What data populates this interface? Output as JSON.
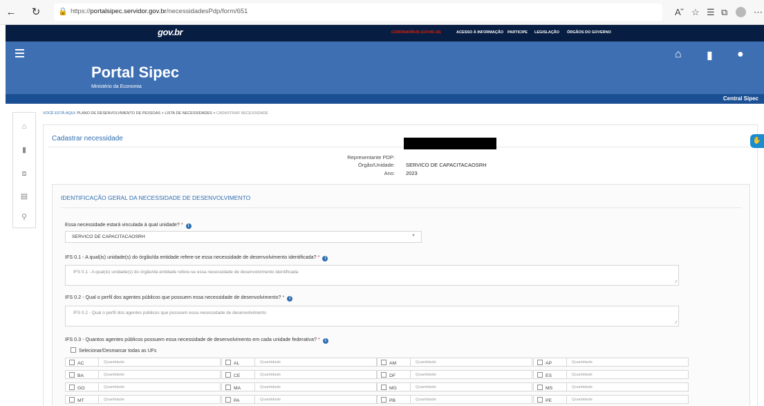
{
  "browser": {
    "back_icon": "arrow-left-icon",
    "reload_icon": "reload-icon",
    "url_prefix": "https://",
    "url_host": "portalsipec.servidor.gov.br",
    "url_path": "/necessidadesPdp/form/651"
  },
  "govbr": {
    "logo": "gov.br",
    "links": [
      "CORONAVÍRUS (COVID-19)",
      "ACESSO À INFORMAÇÃO",
      "PARTICIPE",
      "LEGISLAÇÃO",
      "ÓRGÃOS DO GOVERNO"
    ]
  },
  "header": {
    "title": "Portal Sipec",
    "subtitle": "Ministério da Economia",
    "central": "Central Sipec"
  },
  "breadcrumb": {
    "prefix": "VOCÊ ESTÁ AQUI:",
    "items": [
      "PLANO DE DESENVOLVIMENTO DE PESSOAS",
      "LISTA DE NECESSIDADES",
      "CADASTRAR NECESSIDADE"
    ],
    "separator": ">"
  },
  "page": {
    "title": "Cadastrar necessidade"
  },
  "info": {
    "representante_label": "Representante PDP:",
    "orgao_label": "Órgão/Unidade:",
    "orgao_value": "SERVICO DE CAPACITACAOSRH",
    "ano_label": "Ano:",
    "ano_value": "2023"
  },
  "section": {
    "title": "IDENTIFICAÇÃO GERAL DA NECESSIDADE DE DESENVOLVIMENTO",
    "q1_label": "Essa necessidade estará vinculada à qual unidade?",
    "q1_value": "SERVICO DE CAPACITACAOSRH",
    "q2_label": "IFS 0.1 - A qual(is) unidade(s) do órgão/da entidade refere-se essa necessidade de desenvolvimento identificada?",
    "q2_placeholder": "IFS 0.1 - A qual(is) unidade(s) do órgão/da entidade refere-se essa necessidade de desenvolvimento identificada",
    "q3_label": "IFS 0.2 - Qual o perfil dos agentes públicos que possuem essa necessidade de desenvolvimento?",
    "q3_placeholder": "IFS 0.2 - Qual o perfil dos agentes públicos que possuem essa necessidade de desenvolvimento",
    "q4_label": "IFS 0.3 - Quantos agentes públicos possuem essa necessidade de desenvolvimento em cada unidade federativa?",
    "required_mark": "*",
    "info_glyph": "i",
    "select_all": "Selecionar/Desmarcar todas as UFs",
    "qty_placeholder": "Quantidade",
    "ufs": [
      "AC",
      "AL",
      "AM",
      "AP",
      "BA",
      "CE",
      "DF",
      "ES",
      "GO",
      "MA",
      "MG",
      "MS",
      "MT",
      "PA",
      "PB",
      "PE"
    ]
  },
  "colors": {
    "govbar": "#071d41",
    "header": "#3e6fb2",
    "central": "#1b4f94",
    "accent": "#2e6db0"
  }
}
